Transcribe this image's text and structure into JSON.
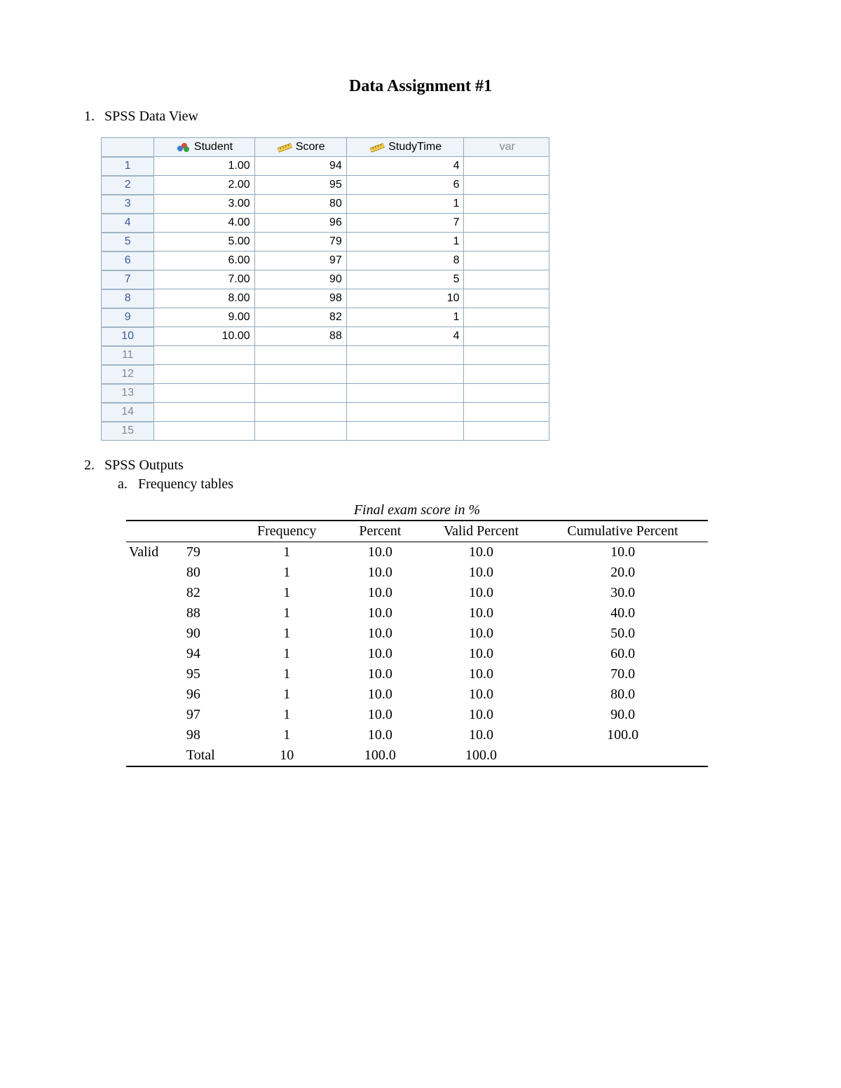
{
  "title": "Data Assignment #1",
  "item1": {
    "num": "1.",
    "label": "SPSS Data View"
  },
  "item2": {
    "num": "2.",
    "label": "SPSS Outputs"
  },
  "item2a": {
    "letter": "a.",
    "label": "Frequency tables"
  },
  "spss": {
    "headers": {
      "c1": "Student",
      "c2": "Score",
      "c3": "StudyTime",
      "c4": "var"
    },
    "rows": [
      {
        "n": "1",
        "student": "1.00",
        "score": "94",
        "study": "4"
      },
      {
        "n": "2",
        "student": "2.00",
        "score": "95",
        "study": "6"
      },
      {
        "n": "3",
        "student": "3.00",
        "score": "80",
        "study": "1"
      },
      {
        "n": "4",
        "student": "4.00",
        "score": "96",
        "study": "7"
      },
      {
        "n": "5",
        "student": "5.00",
        "score": "79",
        "study": "1"
      },
      {
        "n": "6",
        "student": "6.00",
        "score": "97",
        "study": "8"
      },
      {
        "n": "7",
        "student": "7.00",
        "score": "90",
        "study": "5"
      },
      {
        "n": "8",
        "student": "8.00",
        "score": "98",
        "study": "10"
      },
      {
        "n": "9",
        "student": "9.00",
        "score": "82",
        "study": "1"
      },
      {
        "n": "10",
        "student": "10.00",
        "score": "88",
        "study": "4"
      }
    ],
    "empty_rows": [
      "11",
      "12",
      "13",
      "14",
      "15"
    ]
  },
  "freq": {
    "title": "Final exam score in %",
    "headers": {
      "c1": "",
      "c2": "",
      "c3": "Frequency",
      "c4": "Percent",
      "c5": "Valid Percent",
      "c6": "Cumulative Percent"
    },
    "lead": "Valid",
    "rows": [
      {
        "val": "79",
        "f": "1",
        "p": "10.0",
        "vp": "10.0",
        "cp": "10.0"
      },
      {
        "val": "80",
        "f": "1",
        "p": "10.0",
        "vp": "10.0",
        "cp": "20.0"
      },
      {
        "val": "82",
        "f": "1",
        "p": "10.0",
        "vp": "10.0",
        "cp": "30.0"
      },
      {
        "val": "88",
        "f": "1",
        "p": "10.0",
        "vp": "10.0",
        "cp": "40.0"
      },
      {
        "val": "90",
        "f": "1",
        "p": "10.0",
        "vp": "10.0",
        "cp": "50.0"
      },
      {
        "val": "94",
        "f": "1",
        "p": "10.0",
        "vp": "10.0",
        "cp": "60.0"
      },
      {
        "val": "95",
        "f": "1",
        "p": "10.0",
        "vp": "10.0",
        "cp": "70.0"
      },
      {
        "val": "96",
        "f": "1",
        "p": "10.0",
        "vp": "10.0",
        "cp": "80.0"
      },
      {
        "val": "97",
        "f": "1",
        "p": "10.0",
        "vp": "10.0",
        "cp": "90.0"
      },
      {
        "val": "98",
        "f": "1",
        "p": "10.0",
        "vp": "10.0",
        "cp": "100.0"
      }
    ],
    "total": {
      "label": "Total",
      "f": "10",
      "p": "100.0",
      "vp": "100.0",
      "cp": ""
    }
  }
}
